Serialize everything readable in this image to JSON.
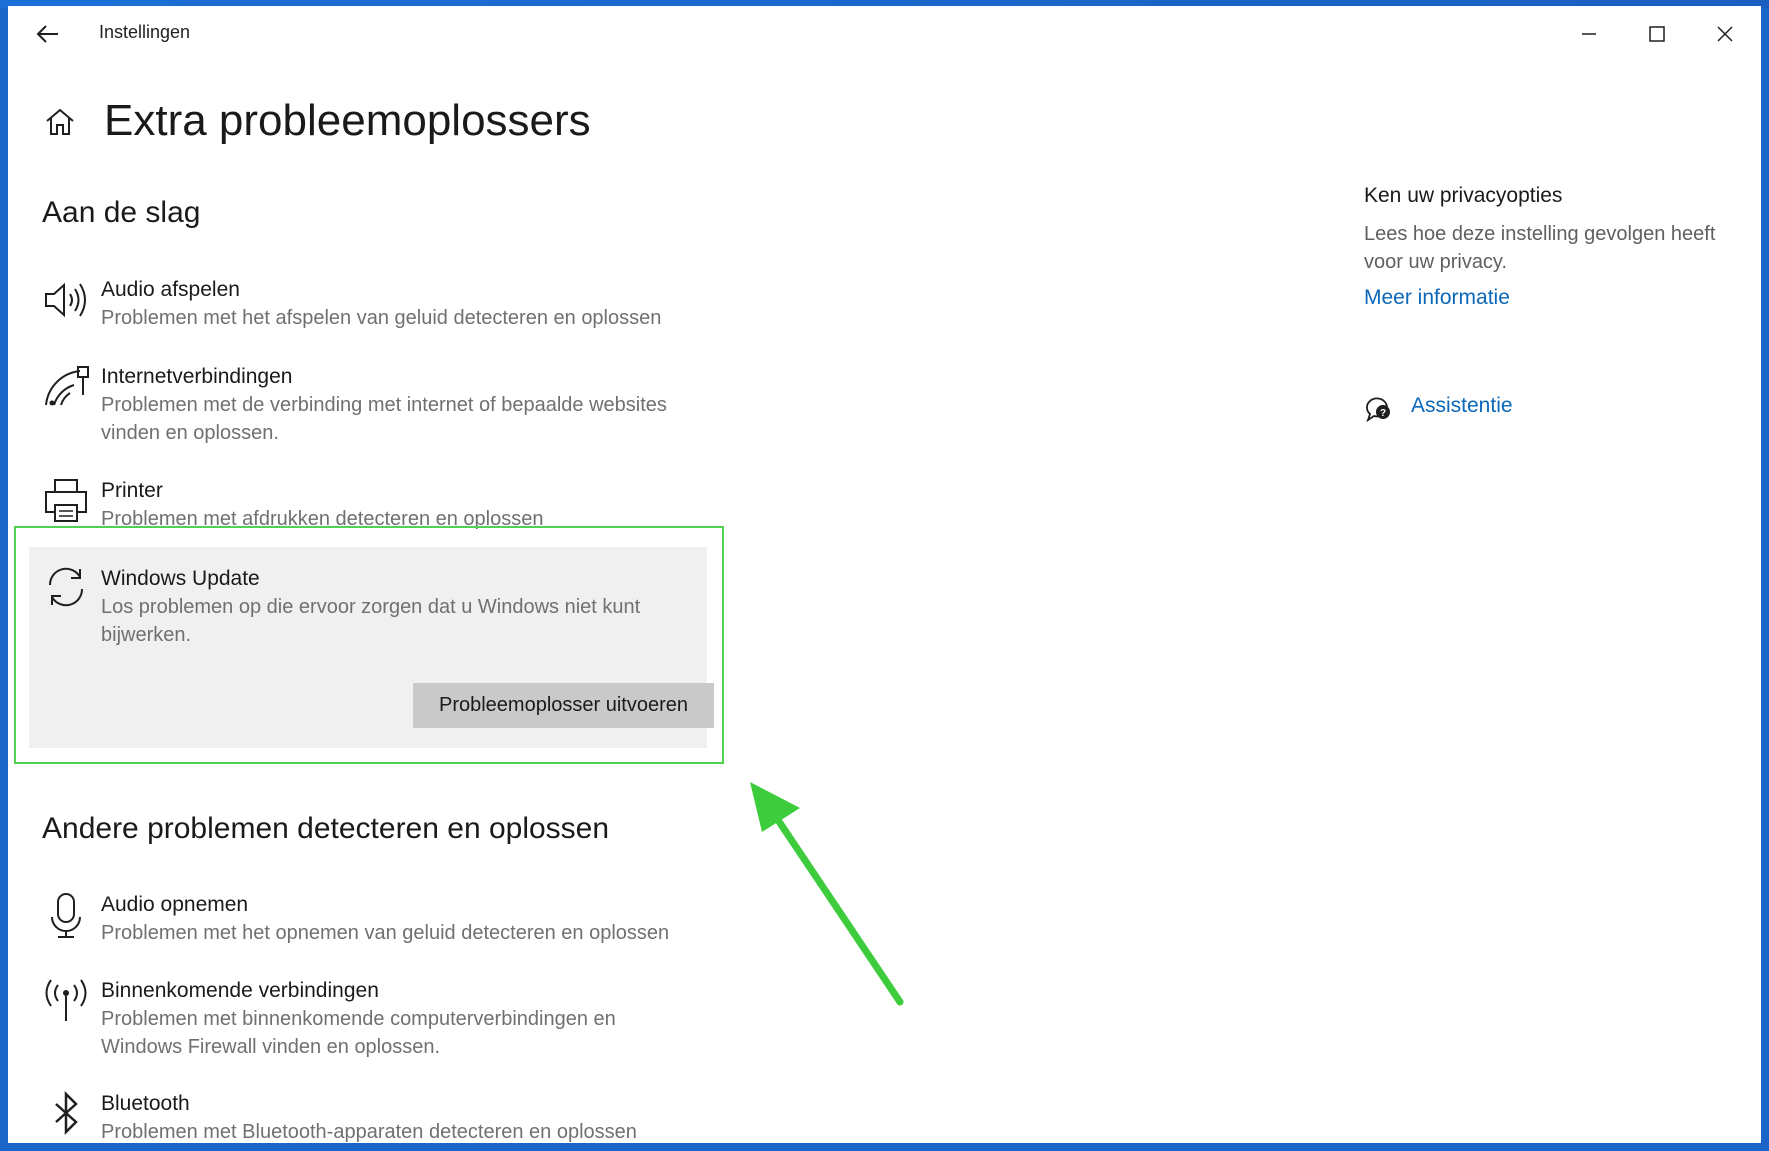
{
  "window": {
    "title": "Instellingen"
  },
  "page": {
    "title": "Extra probleemoplossers"
  },
  "section1": {
    "title": "Aan de slag",
    "items": [
      {
        "name": "Audio afspelen",
        "desc": "Problemen met het afspelen van geluid detecteren en oplossen",
        "icon": "speaker-icon"
      },
      {
        "name": "Internetverbindingen",
        "desc": "Problemen met de verbinding met internet of bepaalde websites vinden en oplossen.",
        "icon": "network-icon"
      },
      {
        "name": "Printer",
        "desc": "Problemen met afdrukken detecteren en oplossen",
        "icon": "printer-icon"
      },
      {
        "name": "Windows Update",
        "desc": "Los problemen op die ervoor zorgen dat u Windows niet kunt bijwerken.",
        "icon": "sync-icon",
        "button": "Probleemoplosser uitvoeren"
      }
    ]
  },
  "section2": {
    "title": "Andere problemen detecteren en oplossen",
    "items": [
      {
        "name": "Audio opnemen",
        "desc": "Problemen met het opnemen van geluid detecteren en oplossen",
        "icon": "microphone-icon"
      },
      {
        "name": "Binnenkomende verbindingen",
        "desc": "Problemen met binnenkomende computerverbindingen en Windows Firewall vinden en oplossen.",
        "icon": "antenna-icon"
      },
      {
        "name": "Bluetooth",
        "desc": "Problemen met Bluetooth-apparaten detecteren en oplossen",
        "icon": "bluetooth-icon"
      }
    ]
  },
  "sidebar": {
    "privacy_heading": "Ken uw privacyopties",
    "privacy_text": "Lees hoe deze instelling gevolgen heeft voor uw privacy.",
    "privacy_link": "Meer informatie",
    "assist_link": "Assistentie"
  },
  "colors": {
    "accent_link": "#0a67b9",
    "highlight": "#4fd24f",
    "selected_bg": "#f0f0f0",
    "button_bg": "#c9c9c9"
  }
}
